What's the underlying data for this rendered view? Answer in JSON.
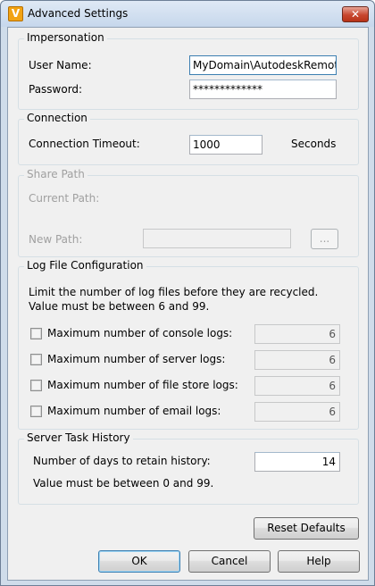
{
  "window": {
    "title": "Advanced Settings",
    "app_icon_glyph": "V",
    "close_glyph": "✕"
  },
  "impersonation": {
    "legend": "Impersonation",
    "user_name_label": "User Name:",
    "user_name_value": "MyDomain\\AutodeskRemote",
    "password_label": "Password:",
    "password_value": "*************"
  },
  "connection": {
    "legend": "Connection",
    "timeout_label": "Connection Timeout:",
    "timeout_value": "1000",
    "unit_label": "Seconds"
  },
  "share_path": {
    "legend": "Share Path",
    "current_path_label": "Current Path:",
    "new_path_label": "New Path:",
    "new_path_value": "",
    "browse_label": "..."
  },
  "log_files": {
    "legend": "Log File Configuration",
    "description": "Limit the number of log files before they are recycled. Value must be between 6 and 99.",
    "items": [
      {
        "label": "Maximum number of console logs:",
        "checked": false,
        "value": "6"
      },
      {
        "label": "Maximum number of server logs:",
        "checked": false,
        "value": "6"
      },
      {
        "label": "Maximum number of file store logs:",
        "checked": false,
        "value": "6"
      },
      {
        "label": "Maximum number of email logs:",
        "checked": false,
        "value": "6"
      }
    ]
  },
  "task_history": {
    "legend": "Server Task History",
    "days_label": "Number of days to retain history:",
    "days_value": "14",
    "hint": "Value must be between 0 and 99."
  },
  "buttons": {
    "reset_defaults": "Reset Defaults",
    "ok": "OK",
    "cancel": "Cancel",
    "help": "Help"
  }
}
